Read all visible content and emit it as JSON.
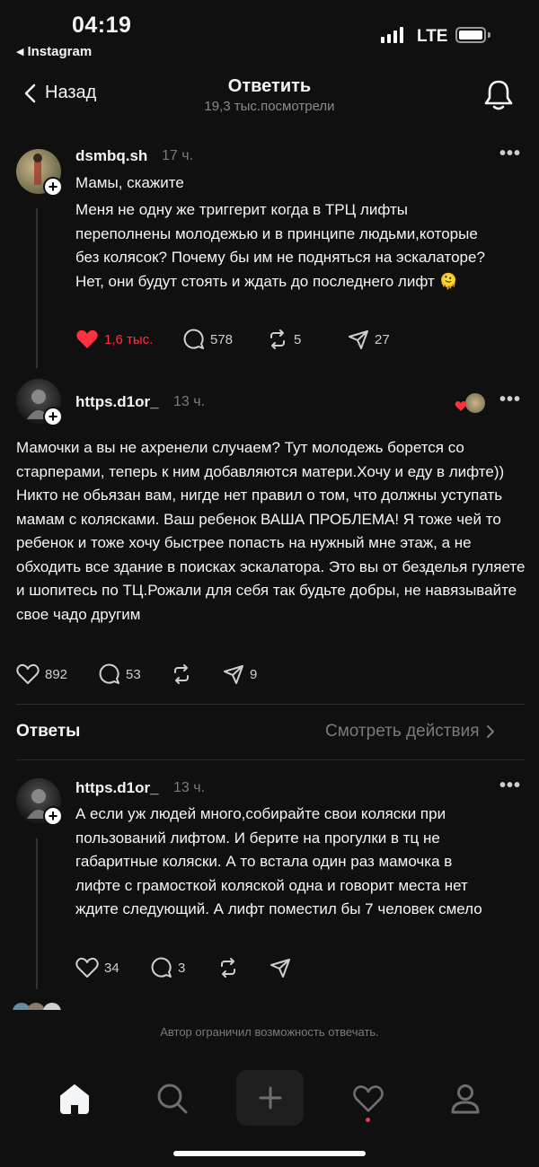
{
  "status_bar": {
    "time": "04:19",
    "back_app": "Instagram",
    "network": "LTE"
  },
  "header": {
    "back_label": "Назад",
    "title": "Ответить",
    "views": "19,3 тыс.посмотрели"
  },
  "main_post": {
    "username": "dsmbq.sh",
    "time": "17 ч.",
    "line1": "Мамы, скажите",
    "body": "Меня не одну же триггерит когда в ТРЦ лифты переполнены молодежью и в принципе людьми,которые без колясок? Почему бы им не подняться на эскалаторе? Нет, они будут стоять и ждать до последнего лифт",
    "emoji": "🫠",
    "likes": "1,6 тыс.",
    "comments": "578",
    "reposts": "5",
    "shares": "27"
  },
  "reply_post": {
    "username": "https.d1or_",
    "time": "13 ч.",
    "body": "Мамочки а вы не ахренели случаем? Тут молодежь борется со старперами, теперь к ним добавляются матери.Хочу и еду в лифте)) Никто не обьязан вам, нигде нет правил о том, что должны уступать мамам с колясками. Ваш ребенок ВАША ПРОБЛЕМА! Я тоже чей то ребенок и тоже хочу быстрее попасть на нужный мне этаж, а не обходить все здание в поисках эскалатора. Это вы от безделья гуляете и шопитесь по ТЦ.Рожали для себя так будьте добры, не навязывайте свое чадо другим",
    "likes": "892",
    "comments": "53",
    "shares": "9"
  },
  "replies_section": {
    "title": "Ответы",
    "see_activity": "Смотреть действия"
  },
  "sub_reply": {
    "username": "https.d1or_",
    "time": "13 ч.",
    "body": "А если уж людей много,собирайте свои коляски при пользований лифтом. И берите на прогулки в тц не габаритные коляски. А то встала один раз мамочка в лифте с грамосткой коляской одна и говорит места нет ждите следующий. А лифт поместил бы 7 человек смело",
    "likes": "34",
    "comments": "3"
  },
  "footer": {
    "restricted_notice": "Автор ограничил возможность отвечать."
  },
  "colors": {
    "background": "#101010",
    "like_red": "#ff3040",
    "muted_text": "#7a7a7a"
  },
  "icons": [
    "back-chevron-icon",
    "bell-icon",
    "heart-icon",
    "comment-icon",
    "repost-icon",
    "share-icon",
    "more-icon",
    "home-icon",
    "search-icon",
    "plus-icon",
    "profile-icon"
  ]
}
